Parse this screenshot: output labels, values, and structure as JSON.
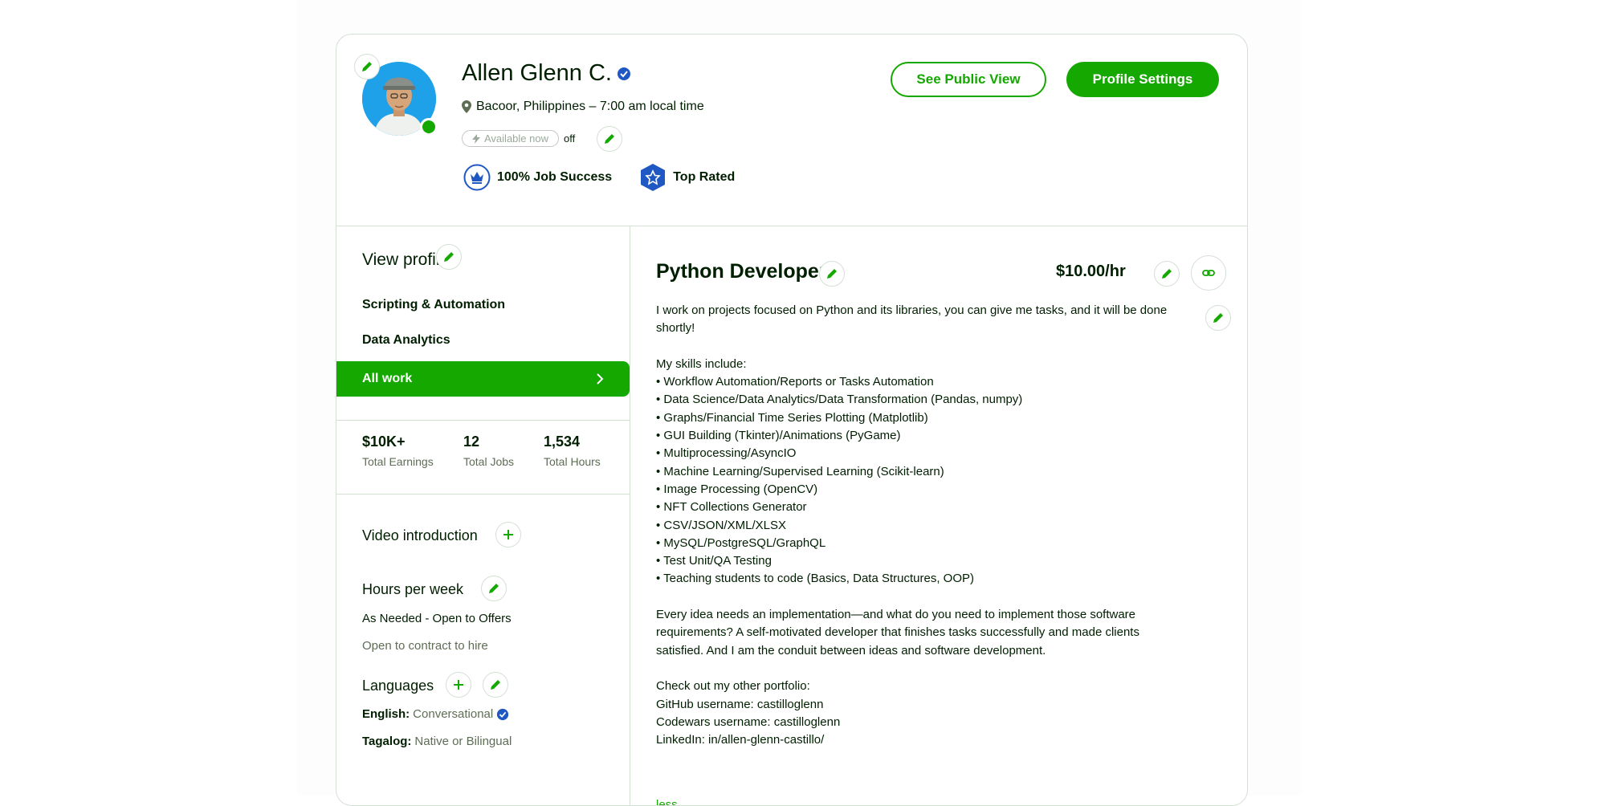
{
  "profile": {
    "name": "Allen Glenn C.",
    "location": "Bacoor, Philippines – 7:00 am local time",
    "availability_label": "Available now",
    "availability_state": "off",
    "job_success": "100% Job Success",
    "top_rated": "Top Rated",
    "accent_color": "#14a800"
  },
  "header": {
    "public_view_label": "See Public View",
    "settings_label": "Profile Settings"
  },
  "sidebar": {
    "title": "View profile",
    "items": [
      {
        "label": "Scripting & Automation"
      },
      {
        "label": "Data Analytics"
      },
      {
        "label": "All work"
      }
    ],
    "stats": [
      {
        "value": "$10K+",
        "label": "Total Earnings"
      },
      {
        "value": "12",
        "label": "Total Jobs"
      },
      {
        "value": "1,534",
        "label": "Total Hours"
      }
    ],
    "video_title": "Video introduction",
    "hours_title": "Hours per week",
    "hours_value": "As Needed - Open to Offers",
    "contract_text": "Open to contract to hire",
    "languages_title": "Languages",
    "languages": [
      {
        "name": "English:",
        "level": "Conversational"
      },
      {
        "name": "Tagalog:",
        "level": "Native or Bilingual"
      }
    ]
  },
  "main": {
    "title": "Python Developer",
    "rate": "$10.00/hr",
    "bio": "I work on projects focused on Python and its libraries, you can give me tasks, and it will be done shortly!\n\nMy skills include:\n• Workflow Automation/Reports or Tasks Automation\n• Data Science/Data Analytics/Data Transformation (Pandas, numpy)\n• Graphs/Financial Time Series Plotting (Matplotlib)\n• GUI Building (Tkinter)/Animations (PyGame)\n• Multiprocessing/AsyncIO\n• Machine Learning/Supervised Learning (Scikit-learn)\n• Image Processing (OpenCV)\n• NFT Collections Generator\n• CSV/JSON/XML/XLSX\n• MySQL/PostgreSQL/GraphQL\n• Test Unit/QA Testing\n• Teaching students to code (Basics, Data Structures, OOP)\n\nEvery idea needs an implementation—and what do you need to implement those software requirements? A self-motivated developer that finishes tasks successfully and made clients satisfied. And I am the conduit between ideas and software development.\n\nCheck out my other portfolio:\nGitHub username: castilloglenn\nCodewars username: castilloglenn\nLinkedIn: in/allen-glenn-castillo/",
    "less_label": "less"
  }
}
